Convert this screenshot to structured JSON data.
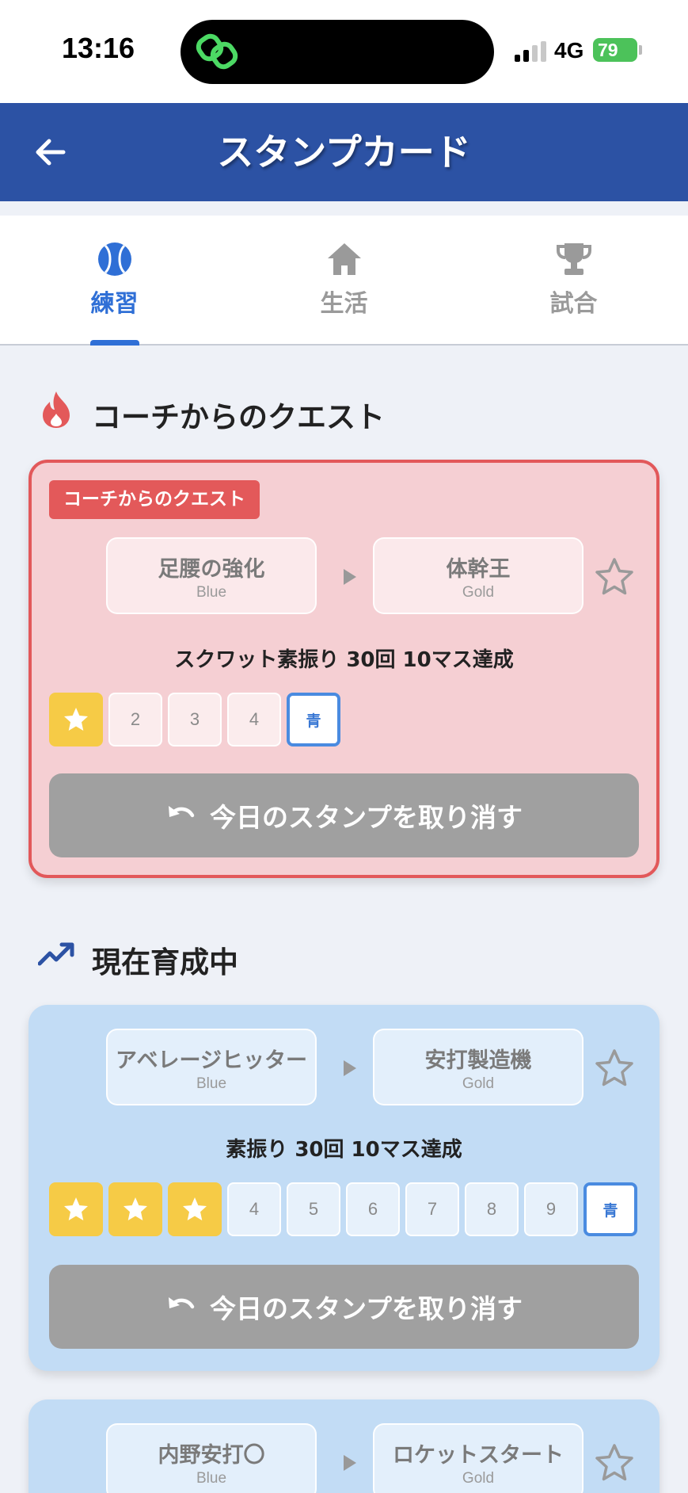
{
  "status": {
    "time": "13:16",
    "network": "4G",
    "battery": "79"
  },
  "header": {
    "title": "スタンプカード"
  },
  "tabs": [
    {
      "label": "練習",
      "icon": "baseball-icon",
      "active": true
    },
    {
      "label": "生活",
      "icon": "home-icon",
      "active": false
    },
    {
      "label": "試合",
      "icon": "trophy-icon",
      "active": false
    }
  ],
  "sections": {
    "quest": {
      "title": "コーチからのクエスト",
      "icon": "fire-icon"
    },
    "training": {
      "title": "現在育成中",
      "icon": "trending-up-icon"
    }
  },
  "quest_card": {
    "badge": "コーチからのクエスト",
    "from": {
      "name": "足腰の強化",
      "rank": "Blue"
    },
    "to": {
      "name": "体幹王",
      "rank": "Gold"
    },
    "goal": "スクワット素振り 30回 10マス達成",
    "stamps": [
      "★",
      "2",
      "3",
      "4",
      "青"
    ],
    "undo_label": "今日のスタンプを取り消す"
  },
  "training_cards": [
    {
      "from": {
        "name": "アベレージヒッター",
        "rank": "Blue"
      },
      "to": {
        "name": "安打製造機",
        "rank": "Gold"
      },
      "goal": "素振り 30回 10マス達成",
      "stamps": [
        "★",
        "★",
        "★",
        "4",
        "5",
        "6",
        "7",
        "8",
        "9",
        "青"
      ],
      "undo_label": "今日のスタンプを取り消す"
    },
    {
      "from": {
        "name": "内野安打〇",
        "rank": "Blue"
      },
      "to": {
        "name": "ロケットスタート",
        "rank": "Gold"
      }
    }
  ],
  "colors": {
    "header": "#2c52a4",
    "tab_active": "#2f6fd6",
    "tab_inactive": "#9a9a9a",
    "quest_border": "#e2585a",
    "stamp_done": "#f6cb46",
    "goal_stamp_border": "#4a8be0"
  }
}
